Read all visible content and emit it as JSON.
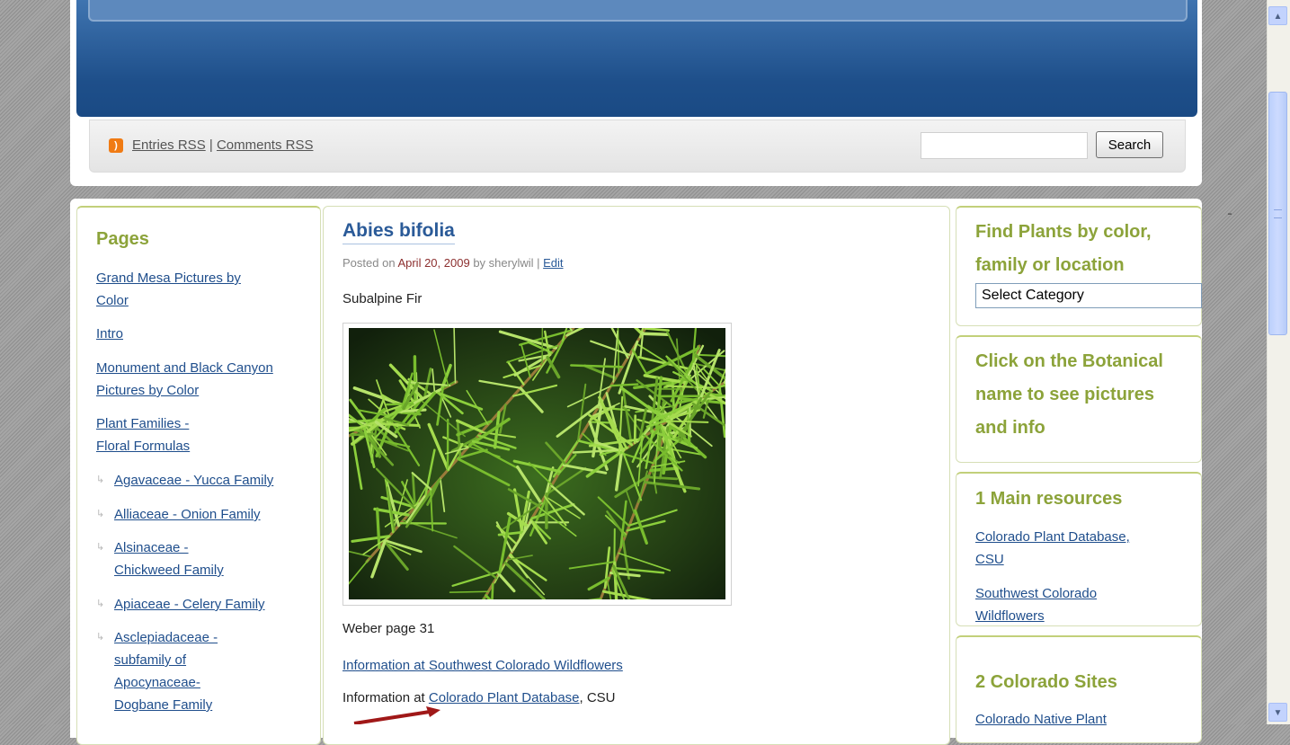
{
  "header": {
    "rss_entries": "Entries RSS",
    "rss_separator": "|",
    "rss_comments": "Comments RSS",
    "search_value": "",
    "search_button": "Search"
  },
  "left_sidebar": {
    "title": "Pages",
    "items": [
      "Grand Mesa Pictures by Color",
      "Intro",
      "Monument and Black Canyon Pictures by Color",
      "Plant Families - Floral Formulas"
    ],
    "subitems": [
      "Agavaceae - Yucca Family",
      "Alliaceae - Onion Family",
      "Alsinaceae - Chickweed Family",
      "Apiaceae - Celery Family",
      "Asclepiadaceae - subfamily of Apocynaceae- Dogbane Family"
    ]
  },
  "post": {
    "title": "Abies bifolia",
    "meta_prefix": "Posted on",
    "date": "April 20, 2009",
    "meta_by": "by sherylwil |",
    "edit": "Edit",
    "common_name": "Subalpine Fir",
    "weber": "Weber page 31",
    "info1": "Information at Southwest Colorado Wildflowers",
    "info2_prefix": "Information at",
    "info2_link": "Colorado Plant Database",
    "info2_suffix": ", CSU"
  },
  "right_sidebar": {
    "find_title": "Find Plants by color, family or location",
    "select_value": "Select Category",
    "click_title": "Click on the Botanical name to see pictures and info",
    "main_resources_title": "1 Main resources",
    "main_resources": [
      "Colorado Plant Database, CSU",
      "Southwest Colorado Wildflowers"
    ],
    "colorado_sites_title": "2 Colorado Sites",
    "colorado_sites": [
      "Colorado Native Plant"
    ]
  },
  "colors": {
    "banner": "#1e4f8a",
    "heading_green": "#8ca33a",
    "link_blue": "#1f4e8c",
    "arrow_red": "#a01818"
  },
  "icons": [
    "rss-icon",
    "arrow-up-icon",
    "arrow-down-icon",
    "red-arrow-icon",
    "subpage-arrow-icon"
  ]
}
